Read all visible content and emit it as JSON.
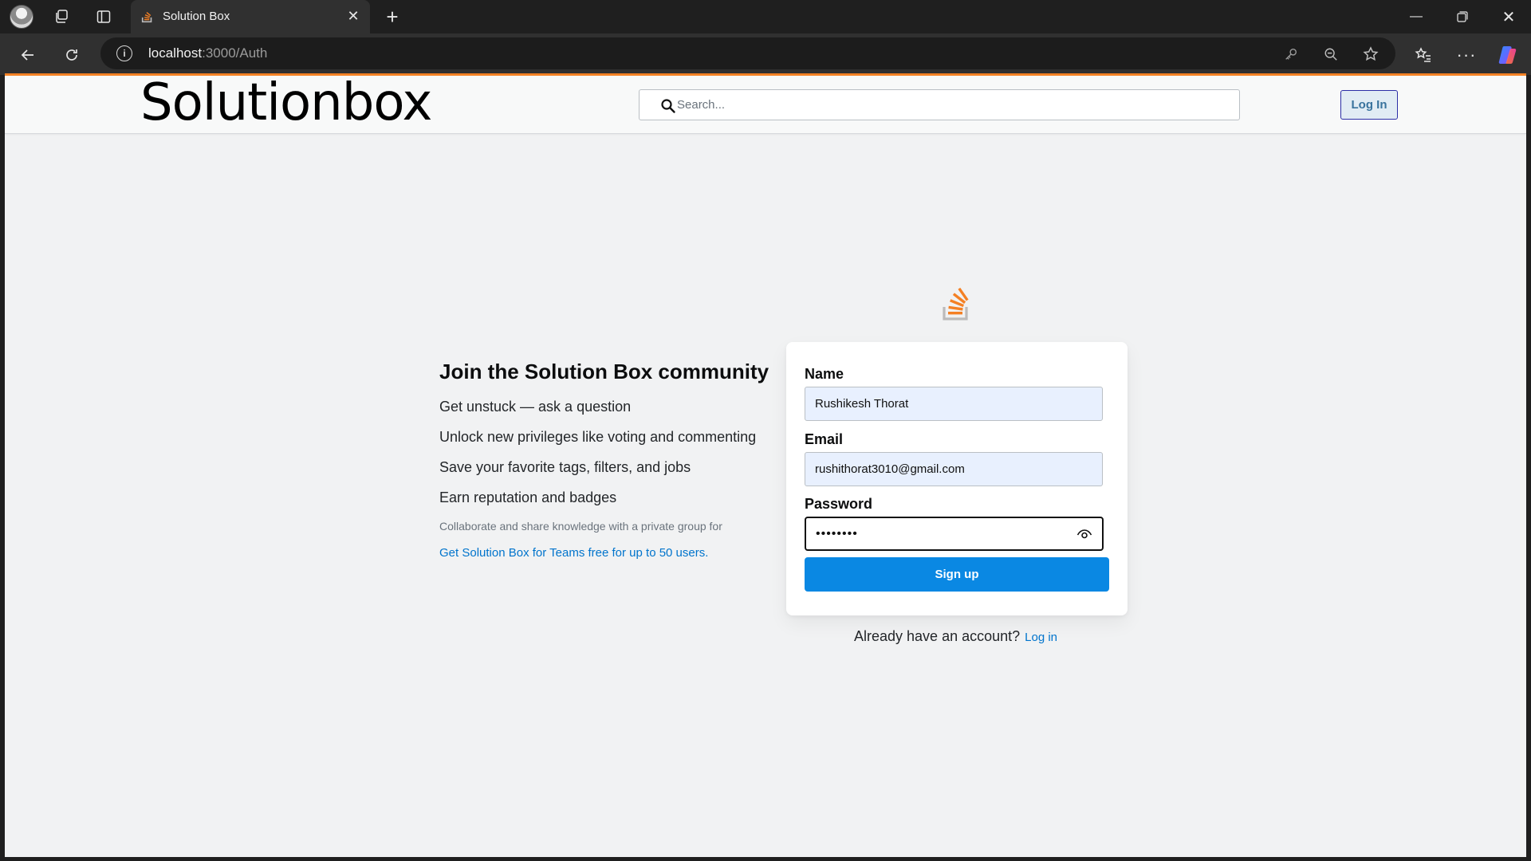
{
  "browser": {
    "tab_title": "Solution Box",
    "url_host": "localhost",
    "url_path": ":3000/Auth",
    "window_controls": [
      "minimize-icon",
      "restore-icon",
      "close-icon"
    ]
  },
  "header": {
    "logo_text": "Solutionbox",
    "search_placeholder": "Search...",
    "login_label": "Log In"
  },
  "intro": {
    "title": "Join the Solution Box community",
    "perks": [
      "Get unstuck — ask a question",
      "Unlock new privileges like voting and commenting",
      "Save your favorite tags, filters, and jobs",
      "Earn reputation and badges"
    ],
    "collab_text": "Collaborate and share knowledge with a private group for",
    "teams_link": "Get Solution Box for Teams free for up to 50 users."
  },
  "form": {
    "name_label": "Name",
    "name_value": "Rushikesh Thorat",
    "email_label": "Email",
    "email_value": "rushithorat3010@gmail.com",
    "password_label": "Password",
    "password_value": "••••••••",
    "signup_label": "Sign up"
  },
  "footer": {
    "already_text": "Already have an account?",
    "login_link": "Log in"
  },
  "colors": {
    "accent_orange": "#f48225",
    "primary_blue": "#0a88e3",
    "link_blue": "#0074cc",
    "autofill_bg": "#e8f0fe"
  }
}
